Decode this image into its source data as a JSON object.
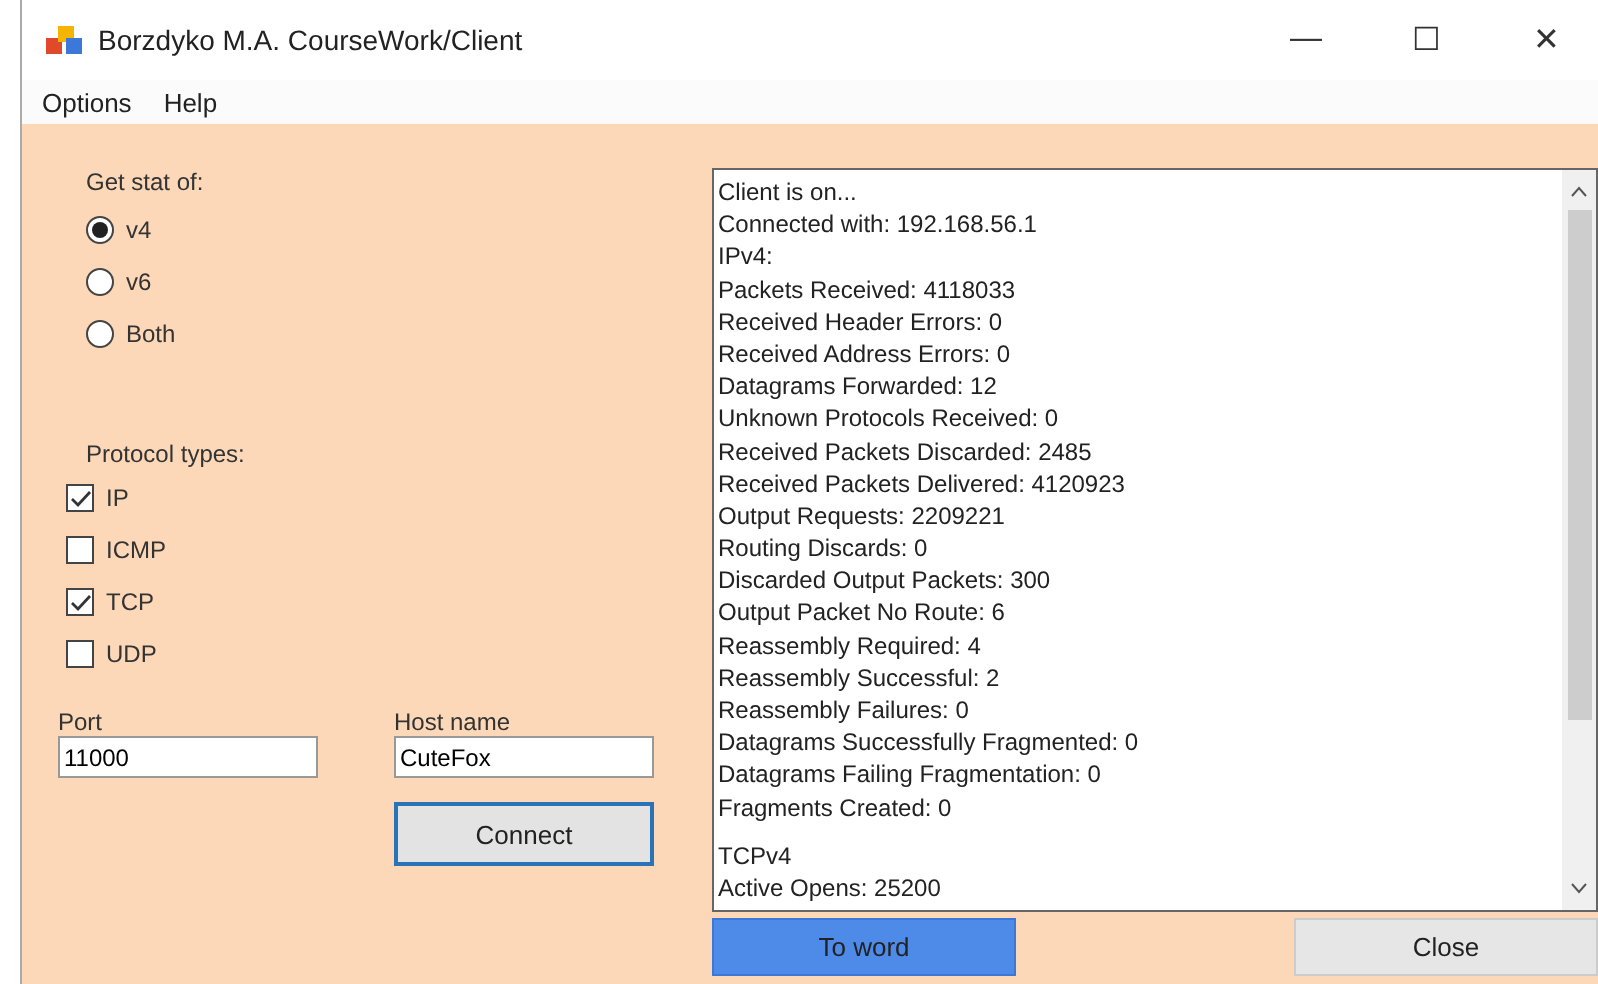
{
  "window": {
    "title": "Borzdyko M.A. CourseWork/Client",
    "controls": [
      "—",
      "☐",
      "✕"
    ]
  },
  "menu": [
    "Options",
    "Help"
  ],
  "stat": {
    "label": "Get stat of:",
    "options": [
      {
        "label": "v4",
        "selected": true
      },
      {
        "label": "v6",
        "selected": false
      },
      {
        "label": "Both",
        "selected": false
      }
    ]
  },
  "protocols": {
    "label": "Protocol types:",
    "items": [
      {
        "label": "IP",
        "checked": true
      },
      {
        "label": "ICMP",
        "checked": false
      },
      {
        "label": "TCP",
        "checked": true
      },
      {
        "label": "UDP",
        "checked": false
      }
    ]
  },
  "port": {
    "label": "Port",
    "value": "11000"
  },
  "host": {
    "label": "Host name",
    "value": "CuteFox"
  },
  "connect_button": "Connect",
  "log": [
    [
      "Client is on...",
      "Connected with: 192.168.56.1",
      "IPv4:",
      "Packets Received: 4118033",
      "Received Header Errors: 0",
      "Received Address Errors: 0",
      "Datagrams Forwarded: 12",
      "Unknown Protocols Received: 0",
      "Received Packets Discarded: 2485",
      "Received Packets Delivered: 4120923",
      "Output Requests: 2209221",
      "Routing Discards: 0",
      "Discarded Output Packets: 300",
      "Output Packet No Route: 6",
      "Reassembly Required: 4",
      "Reassembly Successful: 2",
      "Reassembly Failures: 0",
      "Datagrams Successfully Fragmented: 0",
      "Datagrams Failing Fragmentation: 0",
      "Fragments Created: 0"
    ],
    [
      "TCPv4",
      "Active Opens: 25200"
    ]
  ],
  "buttons": [
    {
      "label": "To word",
      "selected": true
    },
    {
      "label": "Close",
      "selected": false
    }
  ]
}
